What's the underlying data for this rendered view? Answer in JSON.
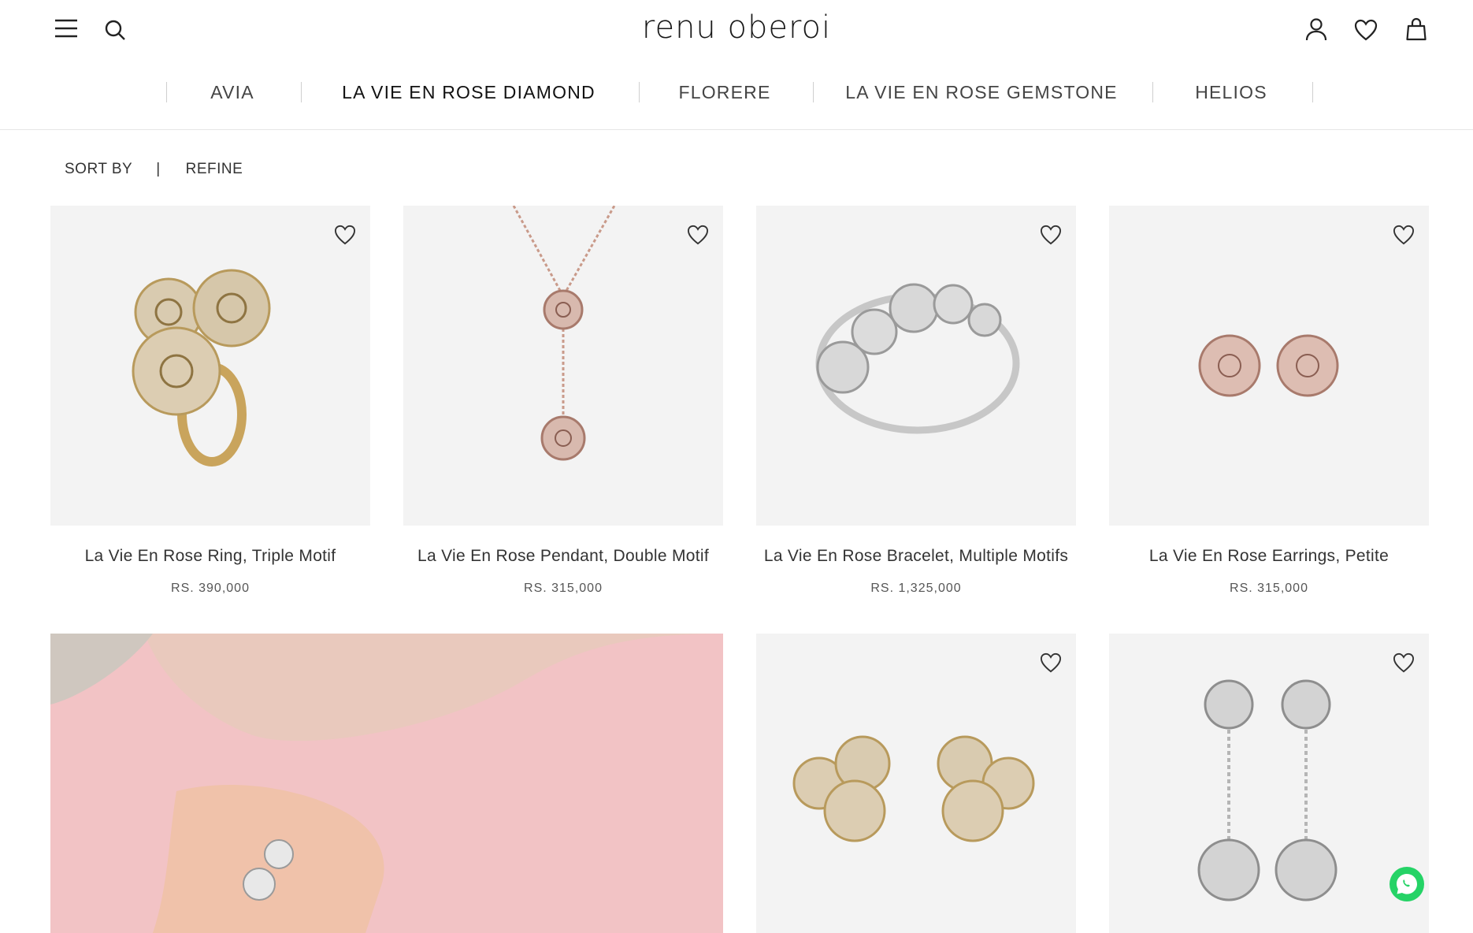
{
  "brand": {
    "logo_text": "renu oberoi"
  },
  "nav": {
    "items": [
      {
        "label": "AVIA",
        "active": false
      },
      {
        "label": "LA VIE EN ROSE DIAMOND",
        "active": true
      },
      {
        "label": "FLORERE",
        "active": false
      },
      {
        "label": "LA VIE EN ROSE GEMSTONE",
        "active": false
      },
      {
        "label": "HELIOS",
        "active": false
      }
    ]
  },
  "toolbar": {
    "sort_label": "SORT BY",
    "separator": "|",
    "refine_label": "REFINE"
  },
  "products": [
    {
      "name": "La Vie En Rose Ring, Triple Motif",
      "price": "RS. 390,000",
      "image": "gold-ring-icon"
    },
    {
      "name": "La Vie En Rose Pendant, Double Motif",
      "price": "RS. 315,000",
      "image": "rose-pendant-icon"
    },
    {
      "name": "La Vie En Rose Bracelet, Multiple Motifs",
      "price": "RS. 1,325,000",
      "image": "silver-bracelet-icon"
    },
    {
      "name": "La Vie En Rose Earrings, Petite",
      "price": "RS. 315,000",
      "image": "rose-earrings-icon"
    }
  ],
  "row2": [
    {
      "image": "model-wearing-ring-photo"
    },
    {
      "image": "gold-earrings-icon"
    },
    {
      "image": "silver-drop-earrings-icon"
    }
  ],
  "colors": {
    "tile_bg": "#f3f3f3",
    "accent_gold": "#c9a45c",
    "rose_gold": "#c99a8a",
    "whatsapp": "#25d366"
  }
}
